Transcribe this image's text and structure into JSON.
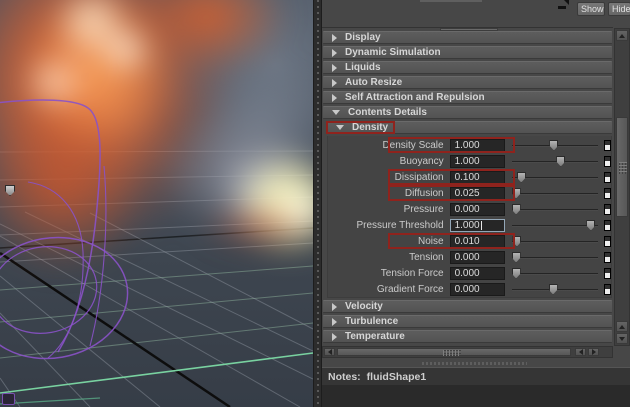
{
  "topbar": {
    "show_label": "Show",
    "hide_label": "Hide"
  },
  "sections": [
    {
      "label": "Display",
      "expanded": false
    },
    {
      "label": "Dynamic Simulation",
      "expanded": false
    },
    {
      "label": "Liquids",
      "expanded": false
    },
    {
      "label": "Auto Resize",
      "expanded": false
    },
    {
      "label": "Self Attraction and Repulsion",
      "expanded": false
    },
    {
      "label": "Contents Details",
      "expanded": true
    }
  ],
  "density": {
    "label": "Density",
    "expanded": true,
    "highlighted": true,
    "rows": [
      {
        "label": "Density Scale",
        "value": "1.000",
        "slider": 0.48,
        "highlighted": true,
        "focused": false
      },
      {
        "label": "Buoyancy",
        "value": "1.000",
        "slider": 0.56,
        "highlighted": false,
        "focused": false
      },
      {
        "label": "Dissipation",
        "value": "0.100",
        "slider": 0.1,
        "highlighted": true,
        "focused": false
      },
      {
        "label": "Diffusion",
        "value": "0.025",
        "slider": 0.04,
        "highlighted": true,
        "focused": false
      },
      {
        "label": "Pressure",
        "value": "0.000",
        "slider": 0.04,
        "highlighted": false,
        "focused": false
      },
      {
        "label": "Pressure Threshold",
        "value": "1.000",
        "slider": 0.91,
        "highlighted": false,
        "focused": true
      },
      {
        "label": "Noise",
        "value": "0.010",
        "slider": 0.05,
        "highlighted": true,
        "focused": false
      },
      {
        "label": "Tension",
        "value": "0.000",
        "slider": 0.04,
        "highlighted": false,
        "focused": false
      },
      {
        "label": "Tension Force",
        "value": "0.000",
        "slider": 0.04,
        "highlighted": false,
        "focused": false
      },
      {
        "label": "Gradient Force",
        "value": "0.000",
        "slider": 0.47,
        "highlighted": false,
        "focused": false
      }
    ]
  },
  "bottom_sections": [
    {
      "label": "Velocity",
      "expanded": false
    },
    {
      "label": "Turbulence",
      "expanded": false
    },
    {
      "label": "Temperature",
      "expanded": false
    }
  ],
  "notes": {
    "label": "Notes:",
    "value": "fluidShape1"
  },
  "colors": {
    "annotation_red": "#8f231d",
    "panel_bg": "#484848",
    "focus_border": "#93a7b8"
  }
}
